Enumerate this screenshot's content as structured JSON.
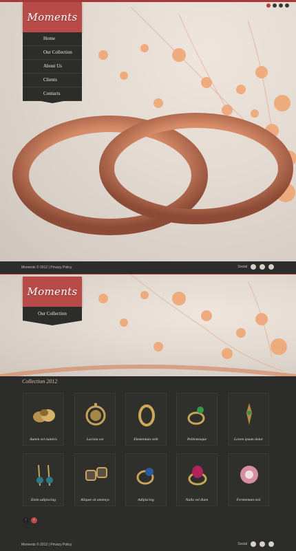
{
  "site": {
    "logo": "Moments"
  },
  "top_nav": {
    "items": [
      "Home",
      "Our Collection",
      "About Us",
      "Clients",
      "Contacts"
    ]
  },
  "footer": {
    "copyright": "Moments © 2012",
    "privacy": "Privacy Policy",
    "social_label": "Social"
  },
  "second_nav": {
    "active": "Our Collection"
  },
  "collection": {
    "title": "Collection 2012",
    "items": [
      "Autem vel eumiris",
      "Lacinia est",
      "Elementum velit",
      "Pellentesque",
      "Lorem ipsum dolor",
      "Enim adipiscing",
      "Aliquet sit ametnys",
      "Adipiscing",
      "Nulla vel diam",
      "Fermentum nisl"
    ],
    "pager": {
      "prev": "‹",
      "next": "›"
    }
  },
  "colors": {
    "accent": "#b84a47",
    "dark": "#2c2c2a",
    "gold": "#d9c7a8"
  }
}
